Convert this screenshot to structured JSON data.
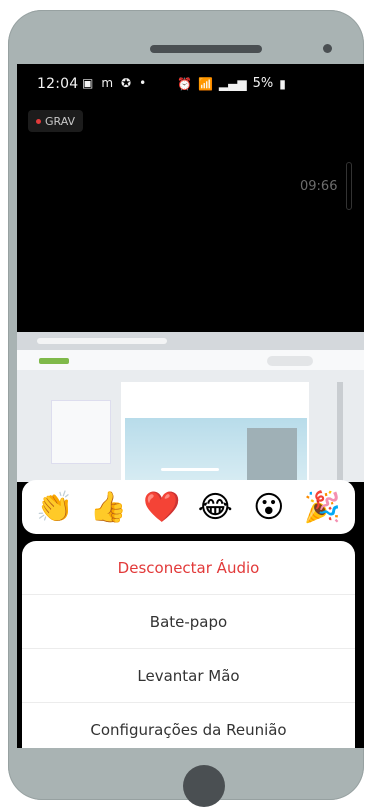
{
  "status_bar": {
    "time": "12:04",
    "left_icons": [
      "image-icon",
      "m-icon",
      "shield-icon",
      "dot-icon"
    ],
    "battery": "5%"
  },
  "meeting": {
    "record_badge": "GRAV",
    "timer": "09:66"
  },
  "reactions": [
    {
      "icon": "clapping-hands",
      "glyph": "👏"
    },
    {
      "icon": "thumbs-up",
      "glyph": "👍"
    },
    {
      "icon": "heart",
      "glyph": "❤️"
    },
    {
      "icon": "tears-of-joy",
      "glyph": "😂"
    },
    {
      "icon": "surprised-face",
      "glyph": "😮"
    },
    {
      "icon": "party-popper",
      "glyph": "🎉"
    }
  ],
  "menu": {
    "items": [
      {
        "label": "Desconectar Áudio",
        "color": "#e23a3a"
      },
      {
        "label": "Bate-papo"
      },
      {
        "label": "Levantar Mão"
      },
      {
        "label": "Configurações da Reunião"
      }
    ]
  }
}
